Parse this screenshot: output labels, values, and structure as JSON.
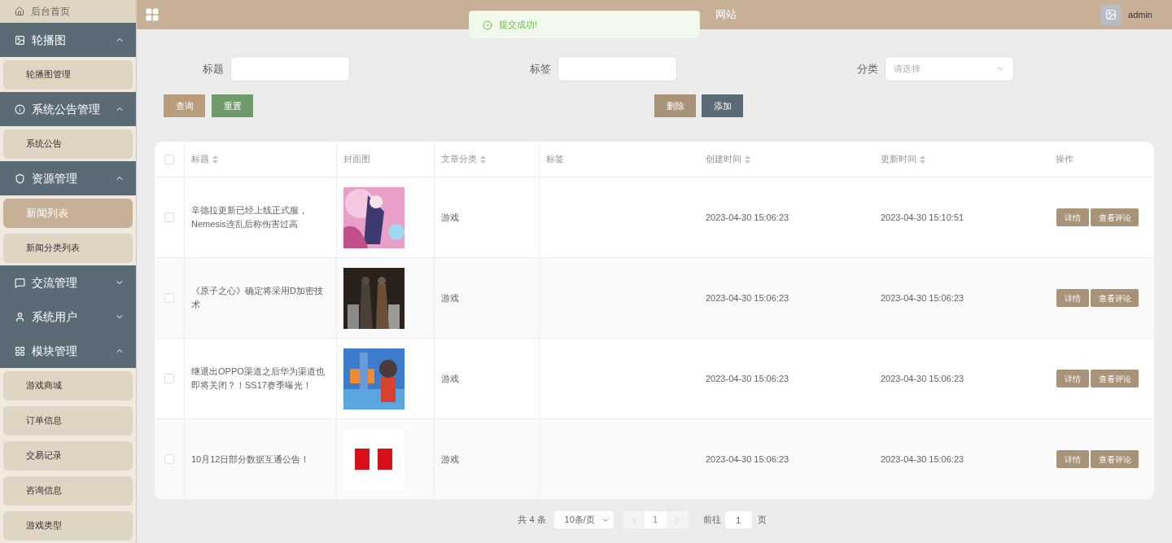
{
  "sidebar": {
    "items": [
      {
        "kind": "link",
        "label": "后台首页"
      },
      {
        "kind": "group",
        "label": "轮播图",
        "expanded": true,
        "children": [
          {
            "label": "轮播图管理",
            "selected": false
          }
        ]
      },
      {
        "kind": "group",
        "label": "系统公告管理",
        "expanded": true,
        "children": [
          {
            "label": "系统公告",
            "selected": false
          }
        ]
      },
      {
        "kind": "group",
        "label": "资源管理",
        "expanded": true,
        "children": [
          {
            "label": "新闻列表",
            "selected": true
          },
          {
            "label": "新闻分类列表",
            "selected": false
          }
        ]
      },
      {
        "kind": "group",
        "label": "交流管理",
        "expanded": false
      },
      {
        "kind": "group",
        "label": "系统用户",
        "expanded": false
      },
      {
        "kind": "group",
        "label": "模块管理",
        "expanded": true,
        "children": [
          {
            "label": "游戏商城",
            "selected": false
          },
          {
            "label": "订单信息",
            "selected": false
          },
          {
            "label": "交易记录",
            "selected": false
          },
          {
            "label": "咨询信息",
            "selected": false
          },
          {
            "label": "游戏类型",
            "selected": false
          }
        ]
      }
    ]
  },
  "header": {
    "title_visible": "网站",
    "user": "admin"
  },
  "toast": {
    "message": "提交成功!"
  },
  "filters": [
    {
      "label": "标题",
      "kind": "input"
    },
    {
      "label": "标签",
      "kind": "input"
    },
    {
      "label": "分类",
      "kind": "select",
      "placeholder": "请选择"
    }
  ],
  "buttons_left": [
    "查询",
    "重置"
  ],
  "buttons_right": [
    "删除",
    "添加"
  ],
  "table": {
    "select_all": {
      "checked": false
    },
    "columns": [
      {
        "label": "标题",
        "sortable": true
      },
      {
        "label": "封面图",
        "sortable": false
      },
      {
        "label": "文章分类",
        "sortable": true
      },
      {
        "label": "标签",
        "sortable": false
      },
      {
        "label": "创建时间",
        "sortable": true
      },
      {
        "label": "更新时间",
        "sortable": true
      },
      {
        "label": "操作",
        "sortable": false
      }
    ],
    "rows": [
      {
        "checked": false,
        "title": "辛德拉更新已经上线正式服，Nemesis连乱后称伤害过高",
        "category": "游戏",
        "created": "2023-04-30 15:06:23",
        "updated": "2023-04-30 15:10:51",
        "actions": [
          "详情",
          "查看评论"
        ]
      },
      {
        "checked": false,
        "title": "《原子之心》确定将采用D加密技术",
        "category": "游戏",
        "created": "2023-04-30 15:06:23",
        "updated": "2023-04-30 15:06:23",
        "actions": [
          "详情",
          "查看评论"
        ]
      },
      {
        "checked": false,
        "title": "继退出OPPO渠道之后华为渠道也即将关闭？！SS17赛季曝光！",
        "category": "游戏",
        "created": "2023-04-30 15:06:23",
        "updated": "2023-04-30 15:06:23",
        "actions": [
          "详情",
          "查看评论"
        ]
      },
      {
        "checked": false,
        "title": "10月12日部分数据互通公告！",
        "category": "游戏",
        "created": "2023-04-30 15:06:23",
        "updated": "2023-04-30 15:06:23",
        "actions": [
          "详情",
          "查看评论"
        ]
      }
    ]
  },
  "pagination": {
    "total": "共 4 条",
    "page_size": "10条/页",
    "pages": [
      {
        "label": "1",
        "selected": true
      }
    ],
    "goto_label": "前往",
    "goto_value": "1",
    "goto_suffix": "页"
  }
}
